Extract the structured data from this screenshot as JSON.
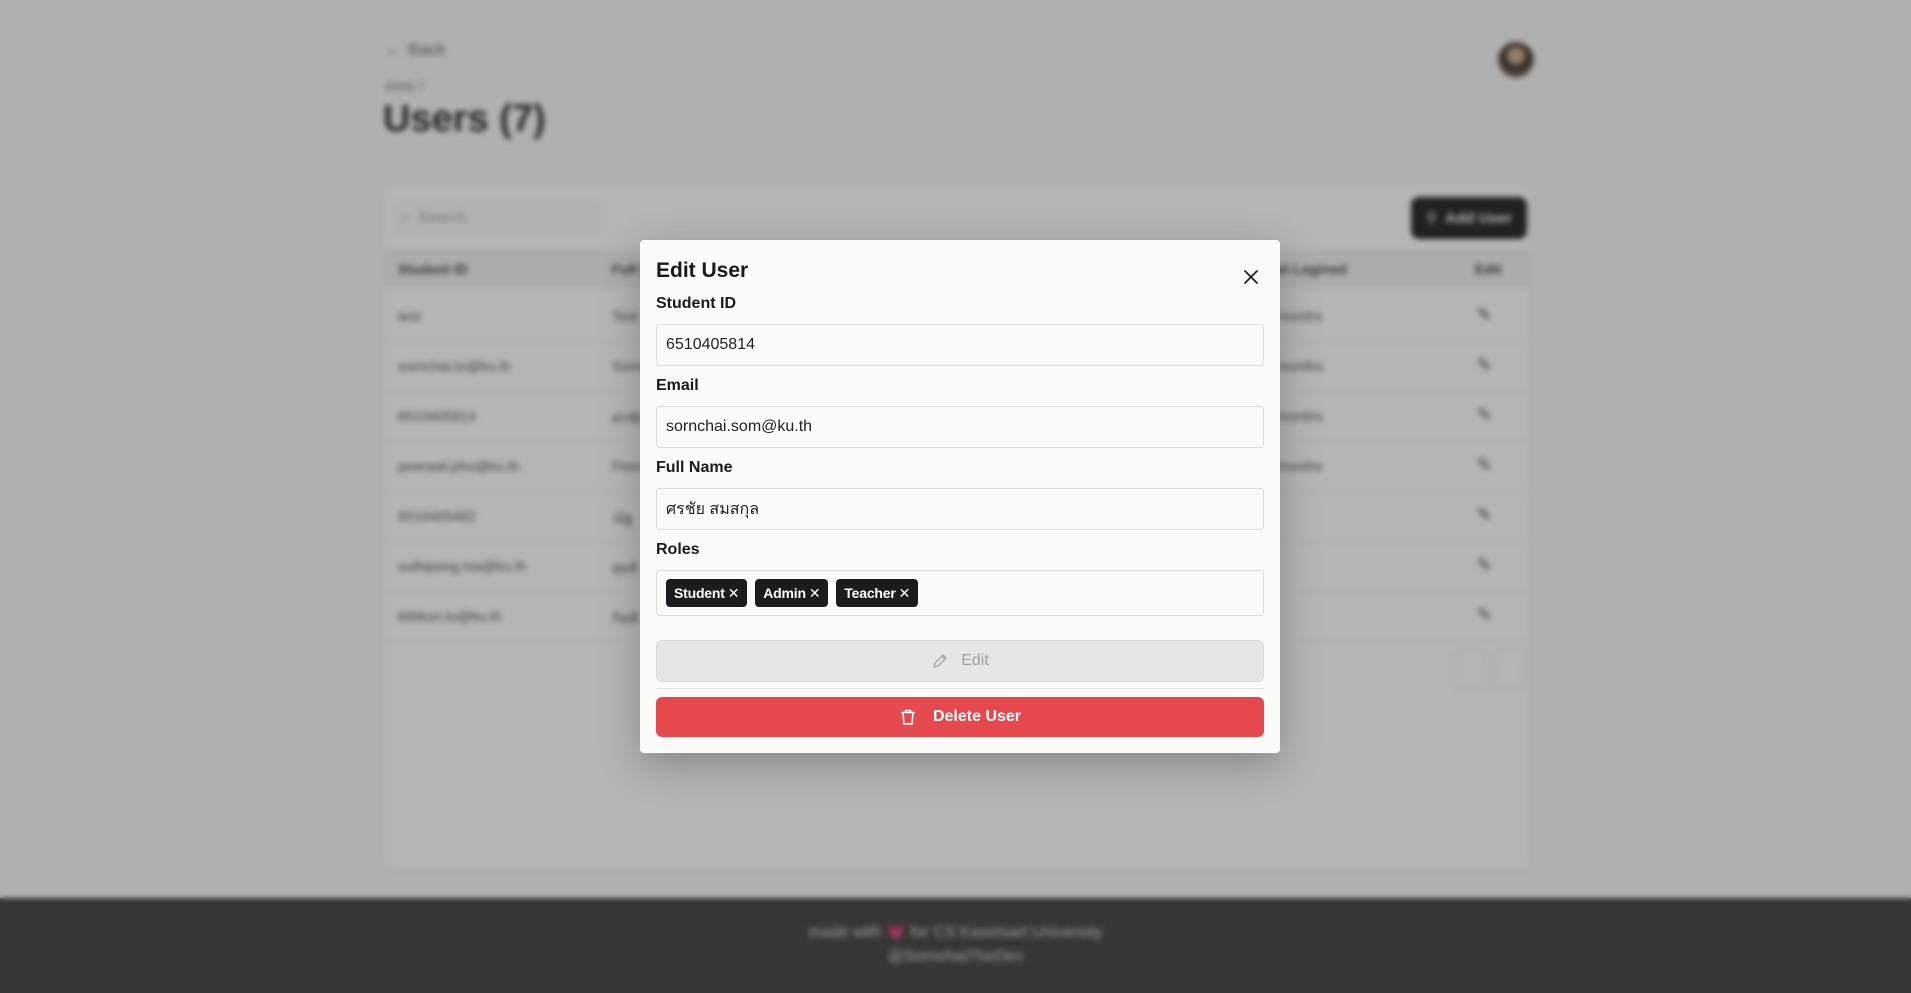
{
  "page": {
    "back_label": "Back",
    "breadcrumb": "cms /",
    "title": "Users (7)",
    "search_placeholder": "Search",
    "add_user_label": "Add User",
    "columns": {
      "student_id": "Student ID",
      "full_name": "Full Name",
      "last_logined": "Last Logined",
      "edit": "Edit"
    },
    "rows": [
      {
        "student_id": "test",
        "full_name": "Test",
        "last_logined": "months"
      },
      {
        "student_id": "sornchai.to@ku.th",
        "full_name": "Sornchai",
        "last_logined": "months"
      },
      {
        "student_id": "6510405814",
        "full_name": "ศรชัย",
        "last_logined": "months"
      },
      {
        "student_id": "peerasit.pho@ku.th",
        "full_name": "Peerasit",
        "last_logined": "months"
      },
      {
        "student_id": "6510405482",
        "full_name": "ณัฐ",
        "last_logined": ""
      },
      {
        "student_id": "suthipong.ma@ku.th",
        "full_name": "สุทธิ",
        "last_logined": ""
      },
      {
        "student_id": "kittikun.tu@ku.th",
        "full_name": "กิตติ",
        "last_logined": ""
      }
    ]
  },
  "footer": {
    "line1_prefix": "made with",
    "heart": "💗",
    "line1_suffix": "for CS Kasetsart University",
    "line2": "@SornchaiTheDev"
  },
  "modal": {
    "title": "Edit User",
    "student_id_label": "Student ID",
    "student_id_value": "6510405814",
    "email_label": "Email",
    "email_value": "sornchai.som@ku.th",
    "full_name_label": "Full Name",
    "full_name_value": "ศรชัย สมสกุล",
    "roles_label": "Roles",
    "roles": [
      "Student",
      "Admin",
      "Teacher"
    ],
    "edit_label": "Edit",
    "delete_label": "Delete User"
  },
  "colors": {
    "danger": "#e5484d",
    "chip": "#1c1c1c",
    "footer": "#333333"
  }
}
